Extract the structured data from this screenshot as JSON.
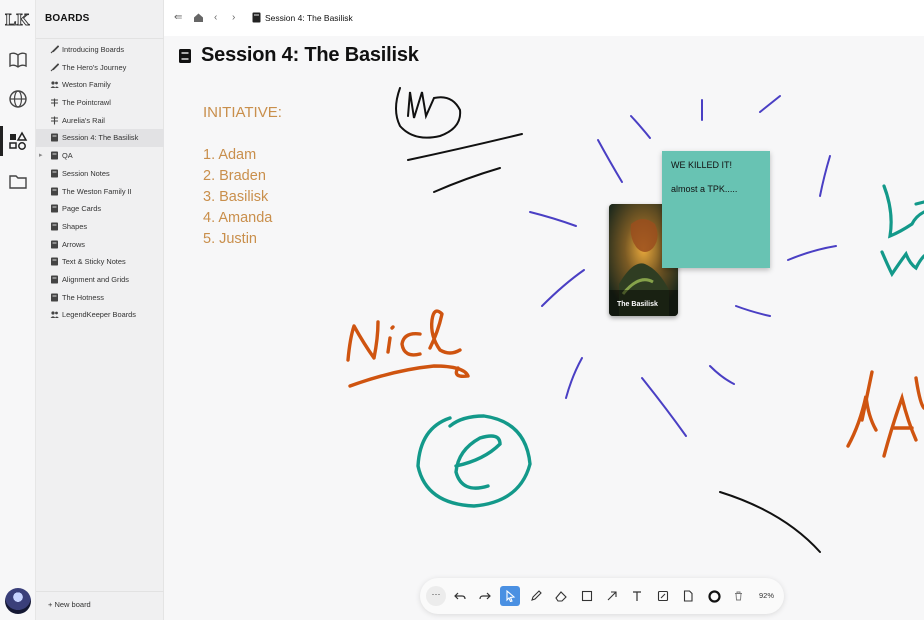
{
  "app": {
    "logo": "LK",
    "rail_icons": [
      "book-icon",
      "globe-icon",
      "shapes-icon",
      "folder-icon"
    ],
    "active_rail": "shapes-icon"
  },
  "sidebar": {
    "title": "BOARDS",
    "items": [
      {
        "label": "Introducing Boards",
        "icon": "brush-icon"
      },
      {
        "label": "The Hero's Journey",
        "icon": "brush-icon"
      },
      {
        "label": "Weston Family",
        "icon": "people-icon"
      },
      {
        "label": "The Pointcrawl",
        "icon": "signpost-icon"
      },
      {
        "label": "Aurelia's Rail",
        "icon": "signpost-icon"
      },
      {
        "label": "Session 4: The Basilisk",
        "icon": "book-icon",
        "active": true
      },
      {
        "label": "QA",
        "icon": "book-icon",
        "collapsed": true
      },
      {
        "label": "Session Notes",
        "icon": "book-icon"
      },
      {
        "label": "The Weston Family II",
        "icon": "book-icon"
      },
      {
        "label": "Page Cards",
        "icon": "book-icon"
      },
      {
        "label": "Shapes",
        "icon": "book-icon"
      },
      {
        "label": "Arrows",
        "icon": "book-icon"
      },
      {
        "label": "Text & Sticky Notes",
        "icon": "book-icon"
      },
      {
        "label": "Alignment and Grids",
        "icon": "book-icon"
      },
      {
        "label": "The Hotness",
        "icon": "book-icon"
      },
      {
        "label": "LegendKeeper Boards",
        "icon": "people-icon"
      }
    ],
    "new_board": "+ New board"
  },
  "topbar": {
    "breadcrumb": "Session 4: The Basilisk"
  },
  "board": {
    "title": "Session 4: The Basilisk",
    "initiative": {
      "heading": "INITIATIVE:",
      "order": [
        "1. Adam",
        "2. Braden",
        "3. Basilisk",
        "4. Amanda",
        "5. Justin"
      ]
    },
    "sticky": {
      "line1": "WE KILLED IT!",
      "line2": "almost a TPK.....",
      "color": "#68c3b3"
    },
    "card": {
      "label": "The Basilisk"
    },
    "handwriting": {
      "nice": "Nice",
      "yay": "YAY"
    }
  },
  "toolbar": {
    "more": "···",
    "zoom": "92%",
    "accent": "#4a90e2"
  },
  "colors": {
    "ink_purple": "#4a3fc4",
    "ink_orange": "#cf5410",
    "ink_teal": "#13998a",
    "initiative_text": "#c98f4c"
  }
}
